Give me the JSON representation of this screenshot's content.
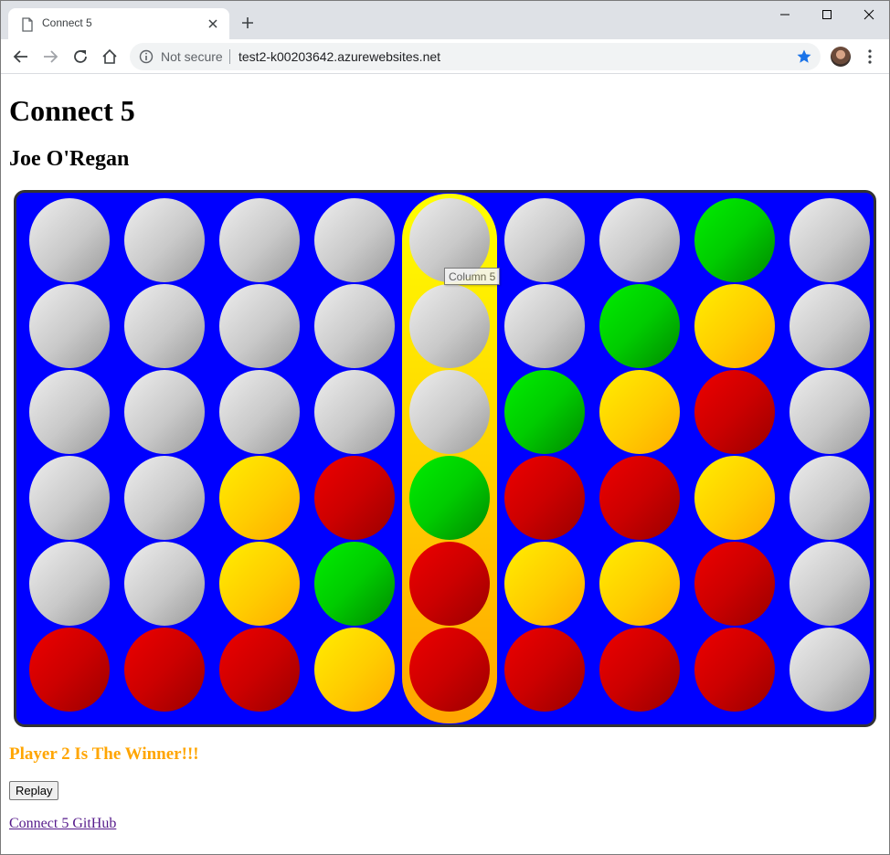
{
  "browser": {
    "tab_title": "Connect 5",
    "security_label": "Not secure",
    "url": "test2-k00203642.azurewebsites.net"
  },
  "page": {
    "title": "Connect 5",
    "author": "Joe O'Regan",
    "winner_message": "Player 2 Is The Winner!!!",
    "replay_label": "Replay",
    "github_link": "Connect 5 GitHub"
  },
  "board": {
    "columns": 9,
    "rows": 6,
    "highlighted_column": 5,
    "hover_tooltip": "Column 5",
    "cells": [
      [
        "empty",
        "empty",
        "empty",
        "empty",
        "empty",
        "empty",
        "empty",
        "green",
        "empty"
      ],
      [
        "empty",
        "empty",
        "empty",
        "empty",
        "empty",
        "empty",
        "green",
        "yellow",
        "empty"
      ],
      [
        "empty",
        "empty",
        "empty",
        "empty",
        "empty",
        "green",
        "yellow",
        "red",
        "empty"
      ],
      [
        "empty",
        "empty",
        "yellow",
        "red",
        "green",
        "red",
        "red",
        "yellow",
        "empty"
      ],
      [
        "empty",
        "empty",
        "yellow",
        "green",
        "red",
        "yellow",
        "yellow",
        "red",
        "empty"
      ],
      [
        "red",
        "red",
        "red",
        "yellow",
        "red",
        "red",
        "red",
        "red",
        "empty"
      ]
    ],
    "colors": {
      "board": "#0000ff",
      "highlight_top": "#ffff00",
      "highlight_bottom": "#ffa500",
      "winner_text": "#ffa500"
    }
  }
}
